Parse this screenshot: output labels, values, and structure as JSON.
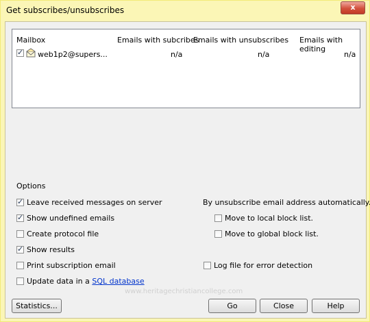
{
  "window": {
    "title": "Get subscribes/unsubscribes",
    "close_glyph": "x"
  },
  "list": {
    "headers": [
      "Mailbox",
      "Emails with subcribes",
      "Emails with unsubscribes",
      "Emails with editing"
    ],
    "rows": [
      {
        "checked": true,
        "mailbox": "web1p2@supers...",
        "subscribes": "n/a",
        "unsubscribes": "n/a",
        "editing": "n/a"
      }
    ]
  },
  "options": {
    "title": "Options",
    "leave_messages": {
      "label": "Leave received messages on server",
      "checked": true
    },
    "show_undefined": {
      "label": "Show undefined emails",
      "checked": true
    },
    "create_protocol": {
      "label": "Create protocol file",
      "checked": false
    },
    "show_results": {
      "label": "Show results",
      "checked": true
    },
    "print_subscription": {
      "label": "Print subscription email",
      "checked": false
    },
    "update_sql": {
      "prefix": "Update data in a ",
      "link": "SQL database",
      "checked": false
    },
    "unsubscribe_heading": "By unsubscribe email address automatically...",
    "move_local": {
      "label": "Move to local block list.",
      "checked": false
    },
    "move_global": {
      "label": "Move to global block list.",
      "checked": false
    },
    "log_error": {
      "label": "Log file for error detection",
      "checked": false
    }
  },
  "buttons": {
    "statistics": "Statistics...",
    "go": "Go",
    "close": "Close",
    "help": "Help"
  },
  "watermark": "www.heritagechristiancollege.com"
}
